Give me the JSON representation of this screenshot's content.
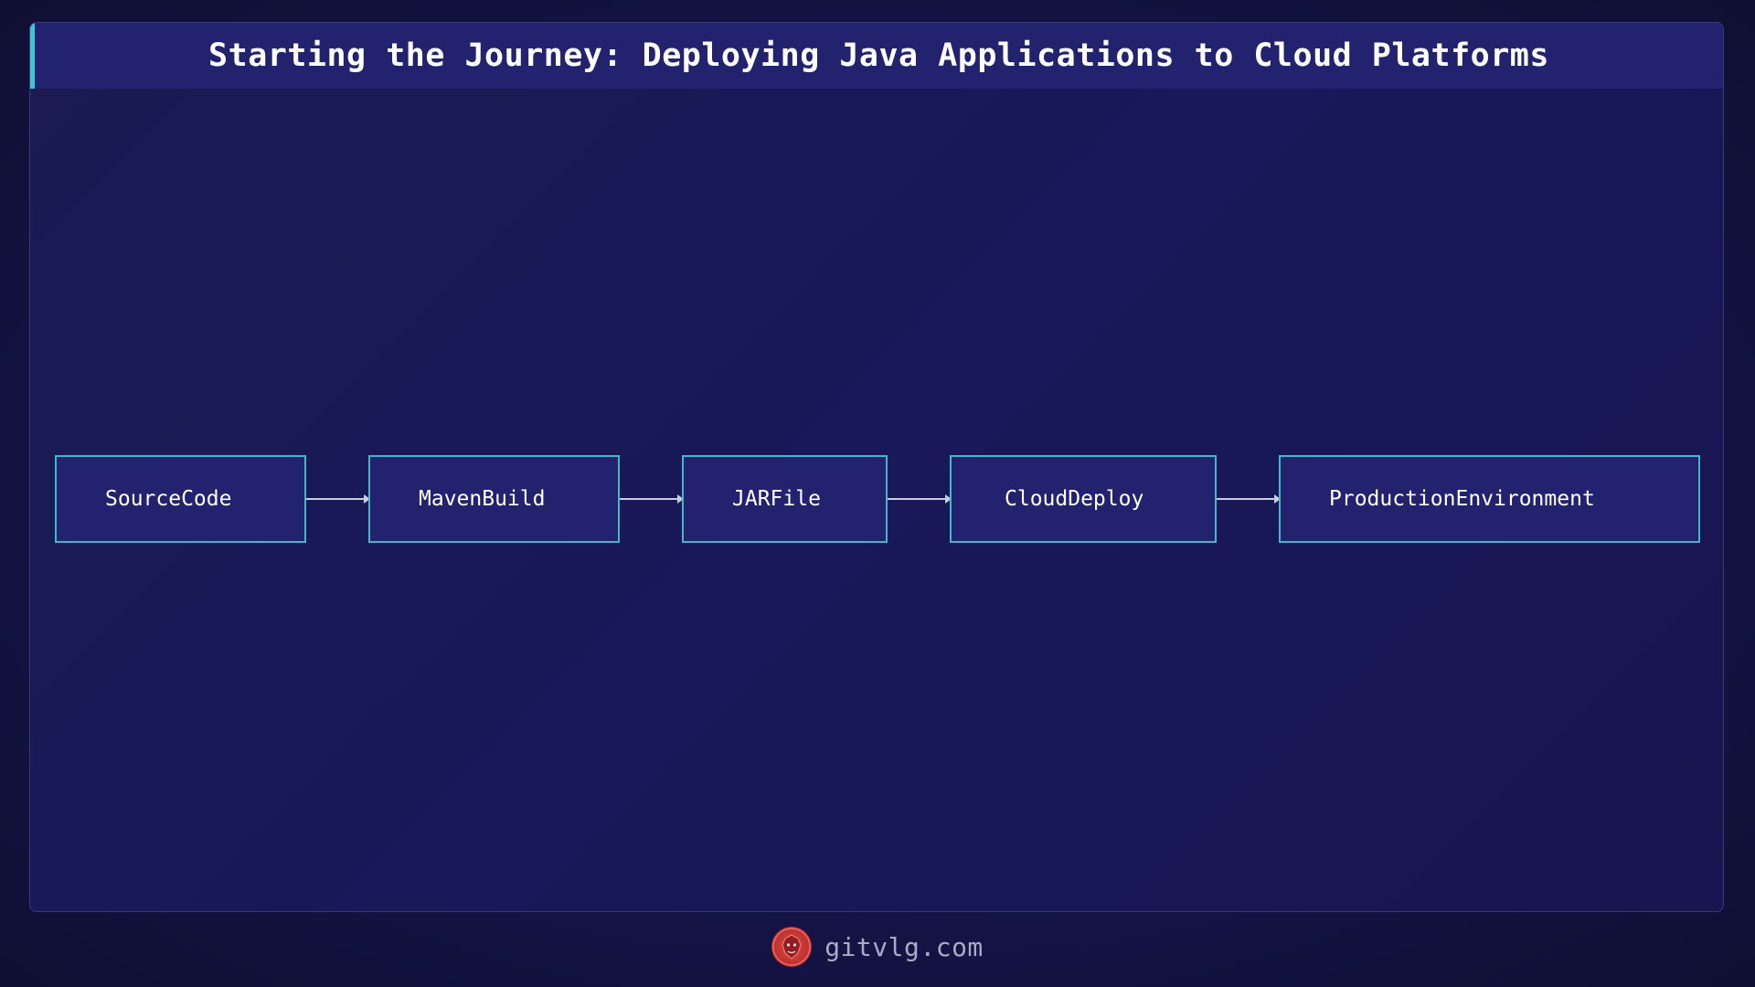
{
  "title": "Starting the Journey: Deploying Java Applications to Cloud Platforms",
  "diagram": {
    "nodes": [
      {
        "id": "source",
        "label": "SourceCode"
      },
      {
        "id": "maven",
        "label": "MavenBuild"
      },
      {
        "id": "jar",
        "label": "JARFile"
      },
      {
        "id": "cloud",
        "label": "CloudDeploy"
      },
      {
        "id": "prod",
        "label": "ProductionEnvironment"
      }
    ],
    "edges": [
      {
        "from": "source",
        "to": "maven"
      },
      {
        "from": "maven",
        "to": "jar"
      },
      {
        "from": "jar",
        "to": "cloud"
      },
      {
        "from": "cloud",
        "to": "prod"
      }
    ]
  },
  "footer": {
    "site": "gitvlg.com",
    "logo_icon": "lion-logo-icon"
  },
  "colors": {
    "background": "#151448",
    "title_bar": "#22226f",
    "accent": "#3fc7d4",
    "node_fill": "#22226f",
    "node_border": "#3fb8c8",
    "arrow": "#c9cbe0",
    "logo": "#d03a37"
  }
}
